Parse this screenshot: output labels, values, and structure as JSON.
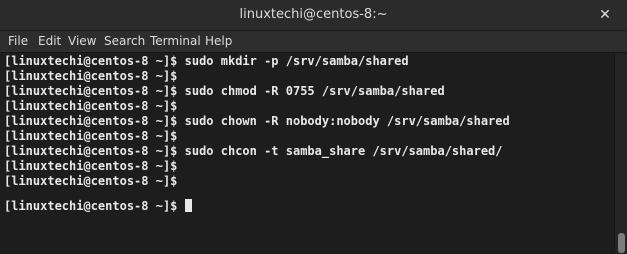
{
  "window": {
    "title": "linuxtechi@centos-8:~",
    "close_symbol": "✕"
  },
  "menu": {
    "items": [
      "File",
      "Edit",
      "View",
      "Search",
      "Terminal",
      "Help"
    ]
  },
  "terminal": {
    "prompt": "[linuxtechi@centos-8 ~]$",
    "lines": [
      "[linuxtechi@centos-8 ~]$ sudo mkdir -p /srv/samba/shared",
      "[linuxtechi@centos-8 ~]$",
      "[linuxtechi@centos-8 ~]$ sudo chmod -R 0755 /srv/samba/shared",
      "[linuxtechi@centos-8 ~]$",
      "[linuxtechi@centos-8 ~]$ sudo chown -R nobody:nobody /srv/samba/shared",
      "[linuxtechi@centos-8 ~]$",
      "[linuxtechi@centos-8 ~]$ sudo chcon -t samba_share /srv/samba/shared/",
      "[linuxtechi@centos-8 ~]$",
      "[linuxtechi@centos-8 ~]$"
    ],
    "active_line": "[linuxtechi@centos-8 ~]$ ",
    "foreground_color": "#e8e8e8",
    "background_color": "#1d1d1d"
  }
}
